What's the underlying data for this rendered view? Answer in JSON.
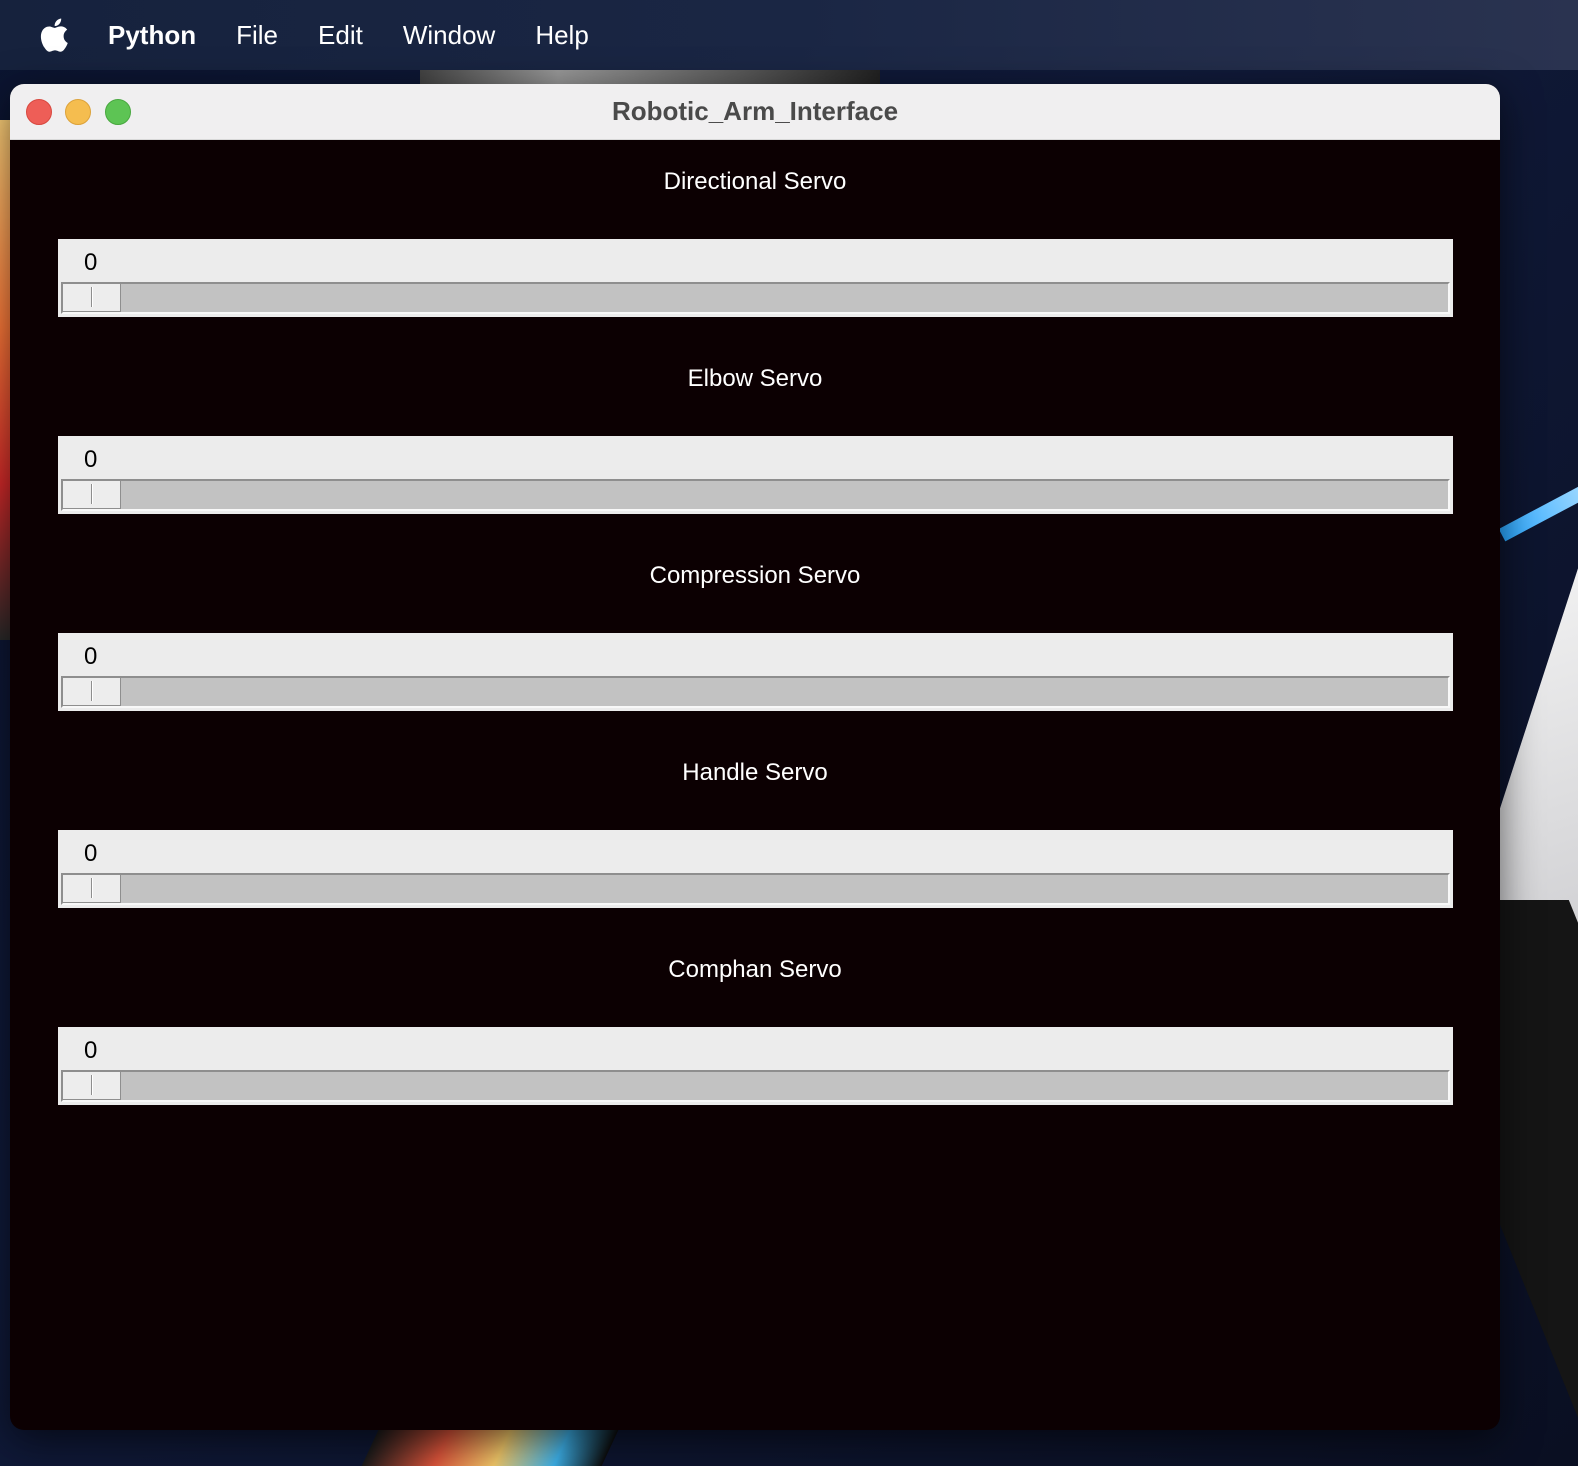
{
  "menubar": {
    "apple_icon": "apple-logo-icon",
    "items": [
      {
        "label": "Python"
      },
      {
        "label": "File"
      },
      {
        "label": "Edit"
      },
      {
        "label": "Window"
      },
      {
        "label": "Help"
      }
    ]
  },
  "window": {
    "title": "Robotic_Arm_Interface",
    "controls": [
      "close",
      "minimize",
      "zoom"
    ]
  },
  "servos": [
    {
      "label": "Directional Servo",
      "value": "0"
    },
    {
      "label": "Elbow Servo",
      "value": "0"
    },
    {
      "label": "Compression Servo",
      "value": "0"
    },
    {
      "label": "Handle Servo",
      "value": "0"
    },
    {
      "label": "Comphan Servo",
      "value": "0"
    }
  ],
  "colors": {
    "window_background": "#0c0002",
    "scale_background": "#ececec",
    "trough": "#c2c2c2",
    "label_text": "#ffffff",
    "close": "#ee5e57",
    "minimize": "#f5bd4f",
    "zoom": "#5dc454"
  }
}
